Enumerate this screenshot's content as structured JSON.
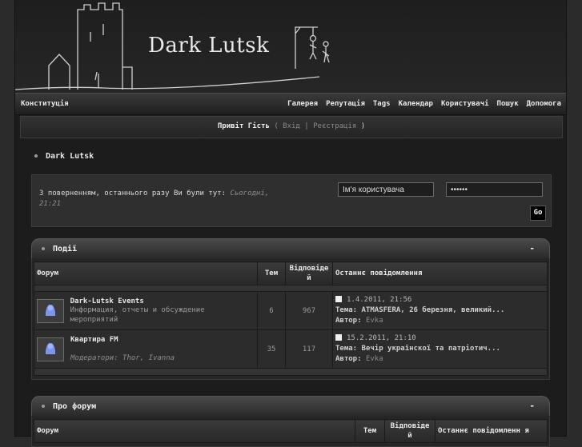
{
  "site": {
    "logo_text": "Dark Lutsk"
  },
  "nav": {
    "left": "Конституція",
    "items": [
      "Галерея",
      "Репутація",
      "Tags",
      "Календар",
      "Користувачі",
      "Пошук",
      "Допомога"
    ]
  },
  "welcome": {
    "greeting": "Привіт Гість",
    "open": "(",
    "login": "Вхід",
    "sep": "|",
    "register": "Реєстрація",
    "close": ")"
  },
  "breadcrumb": "Dark Lutsk",
  "login_box": {
    "message": "З поверненням, останнього разу Ви були тут:",
    "last_visit": "Сьогодні, 21:21",
    "username_placeholder": "Ім'я користувача",
    "password_value": "••••••",
    "go_label": "Go"
  },
  "categories": [
    {
      "title": "Події",
      "min_label": "-",
      "headers": [
        "Форум",
        "Тем",
        "Відповіде й",
        "Останнє повідомлення"
      ],
      "forums": [
        {
          "name": "Dark-Lutsk Events",
          "desc": "Информация, отчеты и обсуждение мероприятий",
          "topics": "6",
          "replies": "967",
          "last_time": "1.4.2011, 21:56",
          "last_topic_label": "Тема:",
          "last_topic": "ATMASFERA, 26 березня, великий...",
          "last_author_label": "Автор:",
          "last_author": "Evka"
        },
        {
          "name": "Квартира FM",
          "desc": "Модератори: Thor, Ivanna",
          "topics": "35",
          "replies": "117",
          "last_time": "15.2.2011, 21:10",
          "last_topic_label": "Тема:",
          "last_topic": "Вечір українскої та патріотич...",
          "last_author_label": "Автор:",
          "last_author": "Evka"
        }
      ]
    },
    {
      "title": "Про форум",
      "min_label": "-",
      "headers": [
        "Форум",
        "Тем",
        "Відповіде й",
        "Останнє повідомленн я"
      ]
    }
  ]
}
